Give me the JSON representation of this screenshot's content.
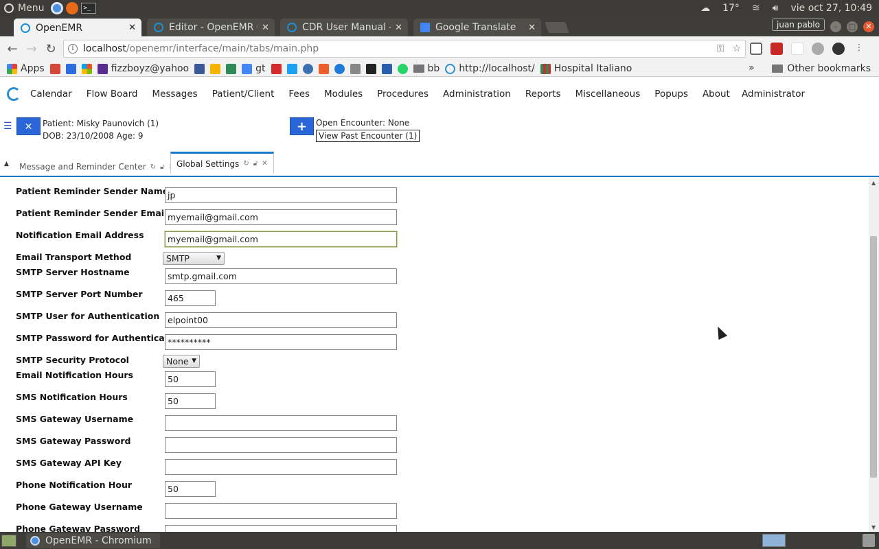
{
  "system": {
    "menu_label": "Menu",
    "temperature": "17°",
    "datetime": "vie oct 27, 10:49"
  },
  "browser": {
    "tabs": [
      {
        "label": "OpenEMR",
        "active": true
      },
      {
        "label": "Editor - OpenEMR C",
        "active": false
      },
      {
        "label": "CDR User Manual - C",
        "active": false
      },
      {
        "label": "Google Translate",
        "active": false
      }
    ],
    "user": "juan pablo",
    "url_host": "localhost",
    "url_path": "/openemr/interface/main/tabs/main.php",
    "bookmarks": [
      {
        "label": "Apps",
        "color": "#e94235"
      },
      {
        "label": "",
        "color": "#d44638"
      },
      {
        "label": "",
        "color": "#2b6de0"
      },
      {
        "label": "",
        "color": "#f25022"
      },
      {
        "label": "fizzboyz@yahoo",
        "color": "#5c2d91"
      },
      {
        "label": "",
        "color": "#3b5998"
      },
      {
        "label": "",
        "color": "#f4b400"
      },
      {
        "label": "",
        "color": "#2e8b57"
      },
      {
        "label": "gt",
        "color": "#4285f4"
      },
      {
        "label": "",
        "color": "#d42b2b"
      },
      {
        "label": "",
        "color": "#1da1f2"
      },
      {
        "label": "",
        "color": "#3a6fb0"
      },
      {
        "label": "",
        "color": "#ec5f2a"
      },
      {
        "label": "",
        "color": "#1f7bd8"
      },
      {
        "label": "",
        "color": "#888888"
      },
      {
        "label": "",
        "color": "#222222"
      },
      {
        "label": "",
        "color": "#2a5fb0"
      },
      {
        "label": "",
        "color": "#25d366"
      },
      {
        "label": "bb",
        "color": "#777777"
      },
      {
        "label": "http://localhost/",
        "color": "#2a8fd8"
      },
      {
        "label": "Hospital Italiano",
        "color": "#2e8b57"
      }
    ],
    "other_bookmarks": "Other bookmarks",
    "more": "»"
  },
  "emr_menu": {
    "items": [
      "Calendar",
      "Flow Board",
      "Messages",
      "Patient/Client",
      "Fees",
      "Modules",
      "Procedures",
      "Administration",
      "Reports",
      "Miscellaneous",
      "Popups",
      "About"
    ],
    "user": "Administrator"
  },
  "patient": {
    "name_line": "Patient: Misky Paunovich (1)",
    "dob_line": "DOB: 23/10/2008 Age: 9",
    "encounter": "Open Encounter: None",
    "past_encounter": "View Past Encounter (1)"
  },
  "emr_tabs": [
    {
      "label": "Message and Reminder Center",
      "active": false
    },
    {
      "label": "Global Settings",
      "active": true
    }
  ],
  "settings": [
    {
      "label": "Patient Reminder Sender Name",
      "type": "text",
      "value": "jp",
      "width": "wide"
    },
    {
      "label": "Patient Reminder Sender Email",
      "type": "text",
      "value": "myemail@gmail.com",
      "width": "wide"
    },
    {
      "label": "Notification Email Address",
      "type": "text",
      "value": "myemail@gmail.com",
      "width": "wide",
      "focused": true
    },
    {
      "label": "Email Transport Method",
      "type": "select",
      "value": "SMTP"
    },
    {
      "label": "SMTP Server Hostname",
      "type": "text",
      "value": "smtp.gmail.com",
      "width": "wide"
    },
    {
      "label": "SMTP Server Port Number",
      "type": "text",
      "value": "465",
      "width": "narrow"
    },
    {
      "label": "SMTP User for Authentication",
      "type": "text",
      "value": "elpoint00",
      "width": "wide"
    },
    {
      "label": "SMTP Password for Authentication",
      "type": "password",
      "value": "**********",
      "width": "wide"
    },
    {
      "label": "SMTP Security Protocol",
      "type": "select",
      "value": "None"
    },
    {
      "label": "Email Notification Hours",
      "type": "text",
      "value": "50",
      "width": "narrow"
    },
    {
      "label": "SMS Notification Hours",
      "type": "text",
      "value": "50",
      "width": "narrow"
    },
    {
      "label": "SMS Gateway Username",
      "type": "text",
      "value": "",
      "width": "wide"
    },
    {
      "label": "SMS Gateway Password",
      "type": "text",
      "value": "",
      "width": "wide"
    },
    {
      "label": "SMS Gateway API Key",
      "type": "text",
      "value": "",
      "width": "wide"
    },
    {
      "label": "Phone Notification Hour",
      "type": "text",
      "value": "50",
      "width": "narrow"
    },
    {
      "label": "Phone Gateway Username",
      "type": "text",
      "value": "",
      "width": "wide"
    },
    {
      "label": "Phone Gateway Password",
      "type": "text",
      "value": "",
      "width": "wide"
    }
  ],
  "taskbar": {
    "window_label": "OpenEMR - Chromium"
  },
  "colors": {
    "accent": "#1a78c8",
    "button_blue": "#2a66d8",
    "panel": "#3c3b37"
  }
}
